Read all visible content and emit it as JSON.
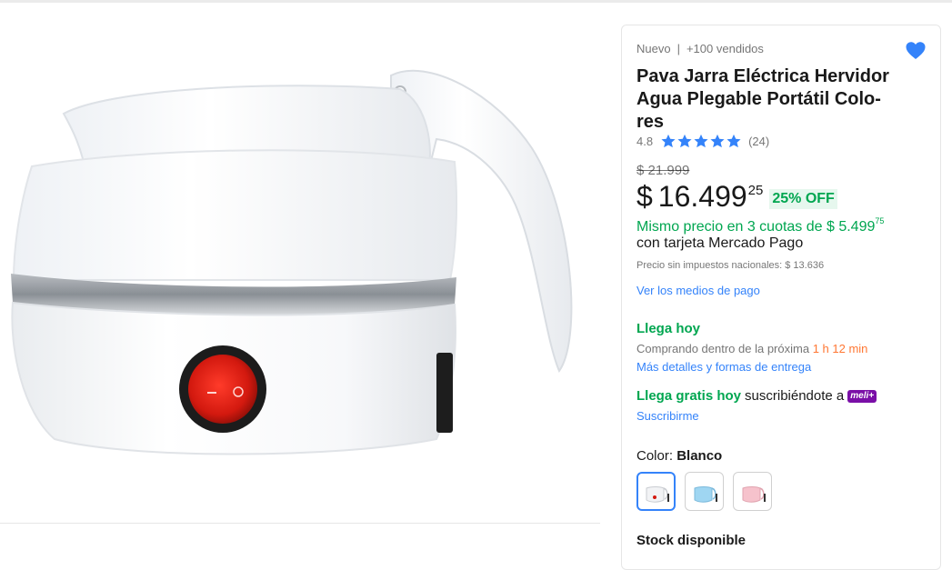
{
  "product": {
    "condition": "Nuevo",
    "sold": "+100 vendidos",
    "title_lines": [
      "Pava Jarra Eléctrica Hervidor",
      "Agua Plegable Portátil Colo-",
      "res"
    ],
    "rating": {
      "score": "4.8",
      "stars": 5,
      "count": "(24)"
    },
    "price": {
      "original": "$ 21.999",
      "currency": "$",
      "integer": "16.499",
      "cents": "25",
      "discount": "25% OFF"
    },
    "installments": {
      "text": "Mismo precio en 3 cuotas de $ 5.499",
      "cents": "75",
      "card_text": "con tarjeta Mercado Pago"
    },
    "tax_note": "Precio sin impuestos nacionales: $ 13.636",
    "payment_link": "Ver los medios de pago",
    "shipping": {
      "arrives": "Llega hoy",
      "buying_within_prefix": "Comprando dentro de la próxima",
      "buying_within_time": "1 h 12 min",
      "details_link": "Más detalles y formas de entrega",
      "free_label": "Llega gratis hoy",
      "free_suffix": "suscribiéndote a",
      "meli_badge": "meli+",
      "subscribe_link": "Suscribirme"
    },
    "color": {
      "label": "Color:",
      "selected": "Blanco",
      "options": [
        "white-kettle-swatch",
        "blue-kettle-swatch",
        "pink-kettle-swatch"
      ]
    },
    "cutoff_text": "Stock disponible"
  },
  "colors": {
    "accent": "#3483fa",
    "green": "#00a650",
    "orange": "#ff7733",
    "meli_purple": "#7a0fa7"
  }
}
